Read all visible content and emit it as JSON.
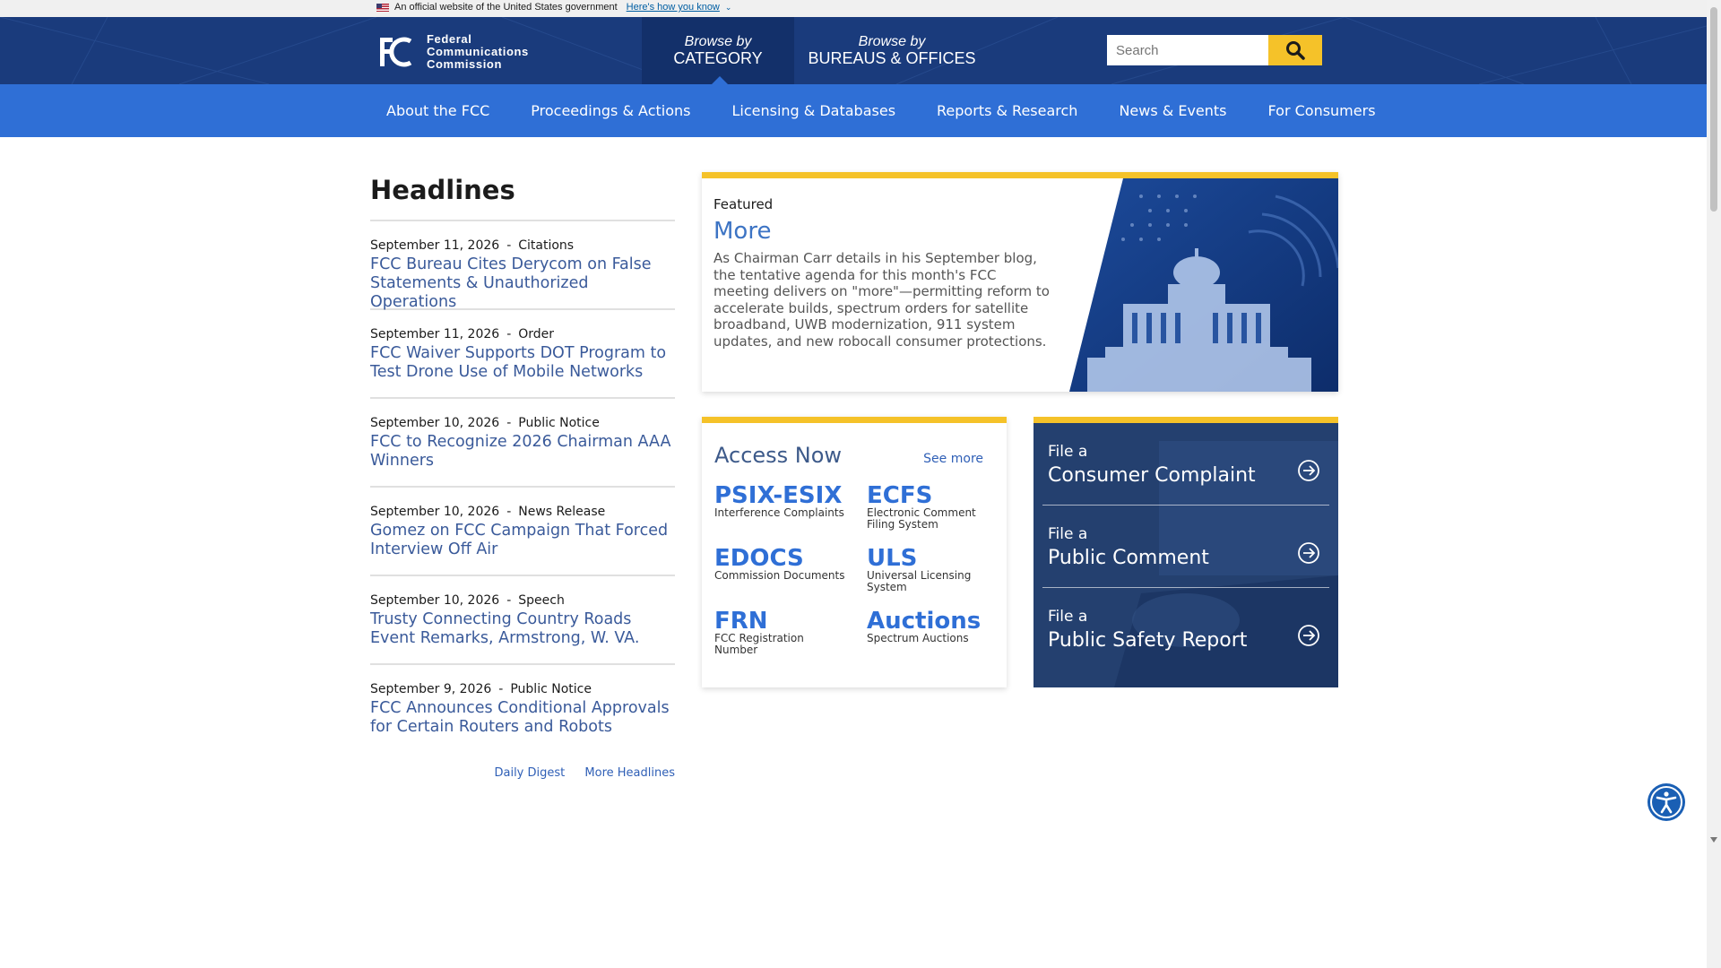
{
  "gov_banner": {
    "text": "An official website of the United States government",
    "link": "Here's how you know",
    "chevron_icon": "chevron-down-icon"
  },
  "logo": {
    "line1": "Federal",
    "line2": "Communications",
    "line3": "Commission"
  },
  "browse": {
    "category": {
      "line1": "Browse by",
      "line2": "CATEGORY"
    },
    "bureaus": {
      "line1": "Browse by",
      "line2": "BUREAUS & OFFICES"
    }
  },
  "search": {
    "placeholder": "Search",
    "icon": "search-icon"
  },
  "nav": [
    "About the FCC",
    "Proceedings & Actions",
    "Licensing & Databases",
    "Reports & Research",
    "News & Events",
    "For Consumers"
  ],
  "headlines": {
    "title": "Headlines",
    "items": [
      {
        "date": "September 11, 2026",
        "sep": "-",
        "type": "Citations",
        "title": "FCC Bureau Cites Derycom on False Statements & Unauthorized Operations"
      },
      {
        "date": "September 11, 2026",
        "sep": "-",
        "type": "Order",
        "title": "FCC Waiver Supports DOT Program to Test Drone Use of Mobile Networks"
      },
      {
        "date": "September 10, 2026",
        "sep": "-",
        "type": "Public Notice",
        "title": "FCC to Recognize 2026 Chairman AAA Winners"
      },
      {
        "date": "September 10, 2026",
        "sep": "-",
        "type": "News Release",
        "title": "Gomez on FCC Campaign That Forced Interview Off Air"
      },
      {
        "date": "September 10, 2026",
        "sep": "-",
        "type": "Speech",
        "title": "Trusty Connecting Country Roads Event Remarks, Armstrong, W. VA."
      },
      {
        "date": "September 9, 2026",
        "sep": "-",
        "type": "Public Notice",
        "title": "FCC Announces Conditional Approvals for Certain Routers and Robots"
      }
    ],
    "daily_digest": "Daily Digest",
    "more_headlines": "More Headlines"
  },
  "featured": {
    "kicker": "Featured",
    "title": "More",
    "description": "As Chairman Carr details in his September blog, the tentative agenda for this month's FCC meeting delivers on \"more\"—permitting reform to accelerate builds, spectrum orders for satellite broadband, UWB modernization, 911 system updates, and new robocall consumer protections."
  },
  "access": {
    "title": "Access Now",
    "see_more": "See more",
    "items": [
      {
        "big": "PSIX-ESIX",
        "small": "Interference Complaints"
      },
      {
        "big": "ECFS",
        "small": "Electronic Comment Filing System"
      },
      {
        "big": "EDOCS",
        "small": "Commission Documents"
      },
      {
        "big": "ULS",
        "small": "Universal Licensing System"
      },
      {
        "big": "FRN",
        "small": "FCC Registration Number"
      },
      {
        "big": "Auctions",
        "small": "Spectrum Auctions"
      }
    ]
  },
  "file": {
    "items": [
      {
        "line1": "File a",
        "line2": "Consumer Complaint"
      },
      {
        "line1": "File a",
        "line2": "Public Comment"
      },
      {
        "line1": "File a",
        "line2": "Public Safety Report"
      }
    ],
    "arrow_icon": "circle-arrow-right-icon"
  },
  "colors": {
    "masthead": "#1a3b7c",
    "nav": "#2f6fd6",
    "accent_yellow": "#f5c229",
    "link": "#3a5a9a"
  }
}
